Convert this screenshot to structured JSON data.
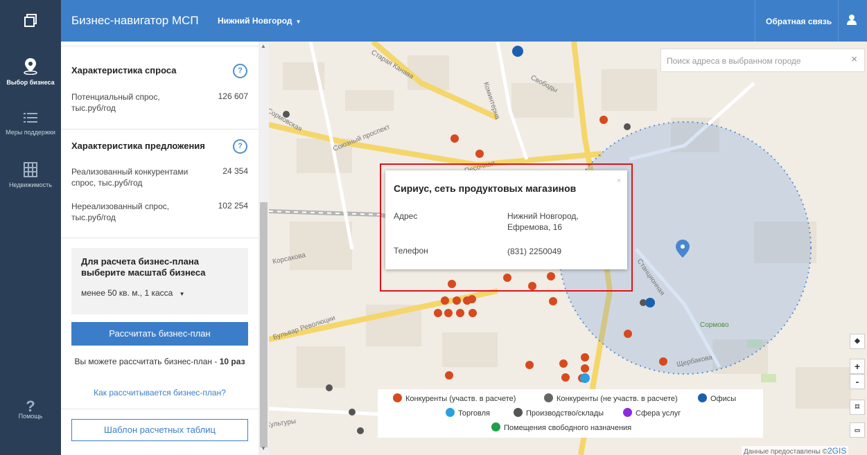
{
  "header": {
    "logo_icon": "window-stack-icon",
    "app_title": "Бизнес-навигатор МСП",
    "city": "Нижний Новгород",
    "feedback": "Обратная связь",
    "user_icon": "user-icon"
  },
  "nav": {
    "items": [
      {
        "label": "Выбор бизнеса",
        "icon": "map-pin-icon",
        "active": true
      },
      {
        "label": "Меры поддержки",
        "icon": "list-icon",
        "active": false
      },
      {
        "label": "Недвижимость",
        "icon": "building-icon",
        "active": false
      }
    ],
    "help": {
      "label": "Помощь",
      "icon": "question-icon"
    }
  },
  "panel": {
    "demand": {
      "title": "Характеристика спроса",
      "help": "?",
      "rows": [
        {
          "label": "Потенциальный спрос, тыс.руб/год",
          "value": "126 607"
        }
      ]
    },
    "supply": {
      "title": "Характеристика предложения",
      "help": "?",
      "rows": [
        {
          "label": "Реализованный конкурентами спрос, тыс.руб/год",
          "value": "24 354"
        },
        {
          "label": "Нереализованный спрос, тыс.руб/год",
          "value": "102 254"
        }
      ]
    },
    "calc": {
      "title": "Для расчета бизнес-плана выберите масштаб бизнеса",
      "select_value": "менее 50 кв. м., 1 касса"
    },
    "calc_button": "Рассчитать бизнес-план",
    "can_calc_prefix": "Вы можете рассчитать бизнес-план - ",
    "can_calc_count": "10",
    "can_calc_suffix": " раз",
    "how_link": "Как рассчитывается бизнес-план?",
    "template_button": "Шаблон расчетных таблиц"
  },
  "map": {
    "search_placeholder": "Поиск адреса в выбранном городе",
    "search_clear": "×",
    "streets": [
      "Старая Канава",
      "Коминтерна",
      "Свободы",
      "Сормовская",
      "Союзный проспект",
      "Песочная",
      "Корсакова",
      "Бульвар Революции",
      "Станционная",
      "Сормово",
      "Щербакова",
      "Культуры"
    ],
    "popup": {
      "title": "Сириус, сеть продуктовых магазинов",
      "close": "×",
      "address_label": "Адрес",
      "address_value": "Нижний Новгород, Ефремова, 16",
      "phone_label": "Телефон",
      "phone_value": "(831) 2250049"
    },
    "controls": [
      "layers-icon",
      "zoom-in-icon",
      "zoom-out-icon",
      "select-area-icon",
      "ruler-icon"
    ],
    "legend": [
      {
        "label": "Конкуренты (участв. в расчете)",
        "color": "#d64a1e"
      },
      {
        "label": "Конкуренты (не участв. в расчете)",
        "color": "#666666"
      },
      {
        "label": "Офисы",
        "color": "#1b5fb0"
      },
      {
        "label": "Торговля",
        "color": "#2d9ee0"
      },
      {
        "label": "Производство/склады",
        "color": "#555555"
      },
      {
        "label": "Сфера услуг",
        "color": "#8a2be2"
      },
      {
        "label": "Помещения свободного назначения",
        "color": "#1fa04a"
      }
    ],
    "attribution": "Данные предоставлены ©",
    "attribution_brand": "2GIS"
  },
  "colors": {
    "accent": "#3d7fc9",
    "nav_bg": "#2a3f57",
    "competitor": "#d64a1e",
    "highlight": "#e0121a"
  }
}
